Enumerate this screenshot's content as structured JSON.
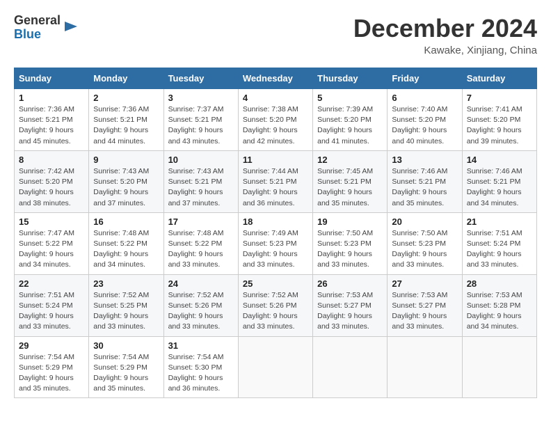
{
  "header": {
    "logo_line1": "General",
    "logo_line2": "Blue",
    "month": "December 2024",
    "location": "Kawake, Xinjiang, China"
  },
  "weekdays": [
    "Sunday",
    "Monday",
    "Tuesday",
    "Wednesday",
    "Thursday",
    "Friday",
    "Saturday"
  ],
  "weeks": [
    [
      {
        "day": "1",
        "info": "Sunrise: 7:36 AM\nSunset: 5:21 PM\nDaylight: 9 hours\nand 45 minutes."
      },
      {
        "day": "2",
        "info": "Sunrise: 7:36 AM\nSunset: 5:21 PM\nDaylight: 9 hours\nand 44 minutes."
      },
      {
        "day": "3",
        "info": "Sunrise: 7:37 AM\nSunset: 5:21 PM\nDaylight: 9 hours\nand 43 minutes."
      },
      {
        "day": "4",
        "info": "Sunrise: 7:38 AM\nSunset: 5:20 PM\nDaylight: 9 hours\nand 42 minutes."
      },
      {
        "day": "5",
        "info": "Sunrise: 7:39 AM\nSunset: 5:20 PM\nDaylight: 9 hours\nand 41 minutes."
      },
      {
        "day": "6",
        "info": "Sunrise: 7:40 AM\nSunset: 5:20 PM\nDaylight: 9 hours\nand 40 minutes."
      },
      {
        "day": "7",
        "info": "Sunrise: 7:41 AM\nSunset: 5:20 PM\nDaylight: 9 hours\nand 39 minutes."
      }
    ],
    [
      {
        "day": "8",
        "info": "Sunrise: 7:42 AM\nSunset: 5:20 PM\nDaylight: 9 hours\nand 38 minutes."
      },
      {
        "day": "9",
        "info": "Sunrise: 7:43 AM\nSunset: 5:20 PM\nDaylight: 9 hours\nand 37 minutes."
      },
      {
        "day": "10",
        "info": "Sunrise: 7:43 AM\nSunset: 5:21 PM\nDaylight: 9 hours\nand 37 minutes."
      },
      {
        "day": "11",
        "info": "Sunrise: 7:44 AM\nSunset: 5:21 PM\nDaylight: 9 hours\nand 36 minutes."
      },
      {
        "day": "12",
        "info": "Sunrise: 7:45 AM\nSunset: 5:21 PM\nDaylight: 9 hours\nand 35 minutes."
      },
      {
        "day": "13",
        "info": "Sunrise: 7:46 AM\nSunset: 5:21 PM\nDaylight: 9 hours\nand 35 minutes."
      },
      {
        "day": "14",
        "info": "Sunrise: 7:46 AM\nSunset: 5:21 PM\nDaylight: 9 hours\nand 34 minutes."
      }
    ],
    [
      {
        "day": "15",
        "info": "Sunrise: 7:47 AM\nSunset: 5:22 PM\nDaylight: 9 hours\nand 34 minutes."
      },
      {
        "day": "16",
        "info": "Sunrise: 7:48 AM\nSunset: 5:22 PM\nDaylight: 9 hours\nand 34 minutes."
      },
      {
        "day": "17",
        "info": "Sunrise: 7:48 AM\nSunset: 5:22 PM\nDaylight: 9 hours\nand 33 minutes."
      },
      {
        "day": "18",
        "info": "Sunrise: 7:49 AM\nSunset: 5:23 PM\nDaylight: 9 hours\nand 33 minutes."
      },
      {
        "day": "19",
        "info": "Sunrise: 7:50 AM\nSunset: 5:23 PM\nDaylight: 9 hours\nand 33 minutes."
      },
      {
        "day": "20",
        "info": "Sunrise: 7:50 AM\nSunset: 5:23 PM\nDaylight: 9 hours\nand 33 minutes."
      },
      {
        "day": "21",
        "info": "Sunrise: 7:51 AM\nSunset: 5:24 PM\nDaylight: 9 hours\nand 33 minutes."
      }
    ],
    [
      {
        "day": "22",
        "info": "Sunrise: 7:51 AM\nSunset: 5:24 PM\nDaylight: 9 hours\nand 33 minutes."
      },
      {
        "day": "23",
        "info": "Sunrise: 7:52 AM\nSunset: 5:25 PM\nDaylight: 9 hours\nand 33 minutes."
      },
      {
        "day": "24",
        "info": "Sunrise: 7:52 AM\nSunset: 5:26 PM\nDaylight: 9 hours\nand 33 minutes."
      },
      {
        "day": "25",
        "info": "Sunrise: 7:52 AM\nSunset: 5:26 PM\nDaylight: 9 hours\nand 33 minutes."
      },
      {
        "day": "26",
        "info": "Sunrise: 7:53 AM\nSunset: 5:27 PM\nDaylight: 9 hours\nand 33 minutes."
      },
      {
        "day": "27",
        "info": "Sunrise: 7:53 AM\nSunset: 5:27 PM\nDaylight: 9 hours\nand 33 minutes."
      },
      {
        "day": "28",
        "info": "Sunrise: 7:53 AM\nSunset: 5:28 PM\nDaylight: 9 hours\nand 34 minutes."
      }
    ],
    [
      {
        "day": "29",
        "info": "Sunrise: 7:54 AM\nSunset: 5:29 PM\nDaylight: 9 hours\nand 35 minutes."
      },
      {
        "day": "30",
        "info": "Sunrise: 7:54 AM\nSunset: 5:29 PM\nDaylight: 9 hours\nand 35 minutes."
      },
      {
        "day": "31",
        "info": "Sunrise: 7:54 AM\nSunset: 5:30 PM\nDaylight: 9 hours\nand 36 minutes."
      },
      null,
      null,
      null,
      null
    ]
  ]
}
